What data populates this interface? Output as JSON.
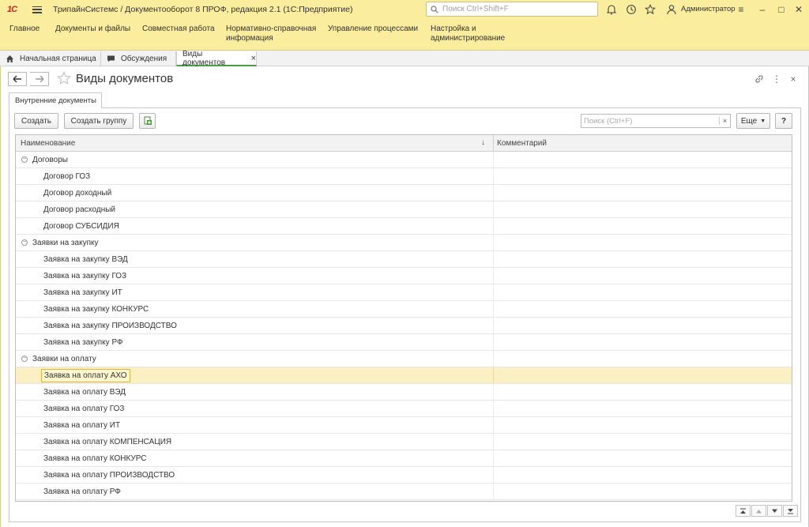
{
  "app": {
    "logo": "1С",
    "title": "ТрипайнСистемс / Документооборот 8 ПРОФ, редакция 2.1  (1С:Предприятие)",
    "search_placeholder": "Поиск Ctrl+Shift+F",
    "user": "Администратор"
  },
  "main_menu": {
    "items": [
      {
        "label": "Главное"
      },
      {
        "label": "Документы и файлы"
      },
      {
        "label": "Совместная работа"
      },
      {
        "label": "Нормативно-справочная информация"
      },
      {
        "label": "Управление процессами"
      },
      {
        "label": "Настройка и администрирование"
      }
    ]
  },
  "window_tabs": [
    {
      "label": "Начальная страница"
    },
    {
      "label": "Обсуждения"
    },
    {
      "label": "Виды документов",
      "close": "×"
    }
  ],
  "form": {
    "title": "Виды документов",
    "inner_tab": "Внутренние документы",
    "buttons": {
      "create": "Создать",
      "create_group": "Создать группу",
      "more": "Еще",
      "help": "?"
    },
    "list_search_placeholder": "Поиск (Ctrl+F)",
    "list_search_clear": "×",
    "columns": {
      "name": "Наименование",
      "comment": "Комментарий",
      "sort_indicator": "↓"
    },
    "rows": [
      {
        "name": "Договоры",
        "group": true,
        "toggle": "−"
      },
      {
        "name": "Договор ГОЗ"
      },
      {
        "name": "Договор доходный"
      },
      {
        "name": "Договор расходный"
      },
      {
        "name": "Договор СУБСИДИЯ"
      },
      {
        "name": "Заявки на закупку",
        "group": true,
        "toggle": "−"
      },
      {
        "name": "Заявка на закупку ВЭД"
      },
      {
        "name": "Заявка на закупку ГОЗ"
      },
      {
        "name": "Заявка на закупку ИТ"
      },
      {
        "name": "Заявка на закупку КОНКУРС"
      },
      {
        "name": "Заявка на закупку ПРОИЗВОДСТВО"
      },
      {
        "name": "Заявка на закупку РФ"
      },
      {
        "name": "Заявки на оплату",
        "group": true,
        "toggle": "−"
      },
      {
        "name": "Заявка на оплату АХО",
        "selected": true
      },
      {
        "name": "Заявка на оплату ВЭД"
      },
      {
        "name": "Заявка на оплату ГОЗ"
      },
      {
        "name": "Заявка на оплату ИТ"
      },
      {
        "name": "Заявка на оплату КОМПЕНСАЦИЯ"
      },
      {
        "name": "Заявка на оплату КОНКУРС"
      },
      {
        "name": "Заявка на оплату ПРОИЗВОДСТВО"
      },
      {
        "name": "Заявка на оплату РФ"
      }
    ]
  },
  "colors": {
    "chrome_bg": "#fbed9e",
    "selection": "#fbefc4",
    "active_tab_underline": "#4a9c4a",
    "logo_red": "#d2231f"
  }
}
